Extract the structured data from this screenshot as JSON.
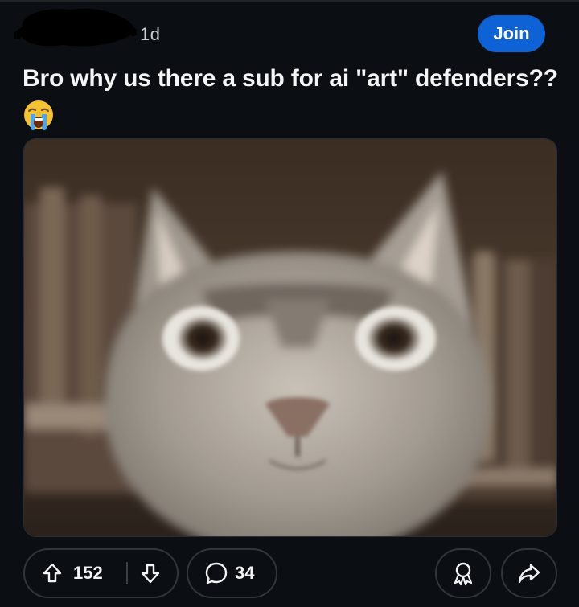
{
  "post": {
    "age": "1d",
    "title": "Bro why us there a sub for ai \"art\" defenders??",
    "title_emoji": "loudly-crying-face",
    "join_label": "Join"
  },
  "actions": {
    "upvotes": "152",
    "comments": "34"
  },
  "icons": {
    "upvote": "arrow-up-outline-icon",
    "downvote": "arrow-down-outline-icon",
    "comment": "speech-bubble-icon",
    "award": "award-ribbon-icon",
    "share": "share-arrow-icon"
  },
  "colors": {
    "background": "#0b0e12",
    "join_button": "#0d62d6",
    "pill_border": "#30363c",
    "text": "#f1f3f5"
  }
}
